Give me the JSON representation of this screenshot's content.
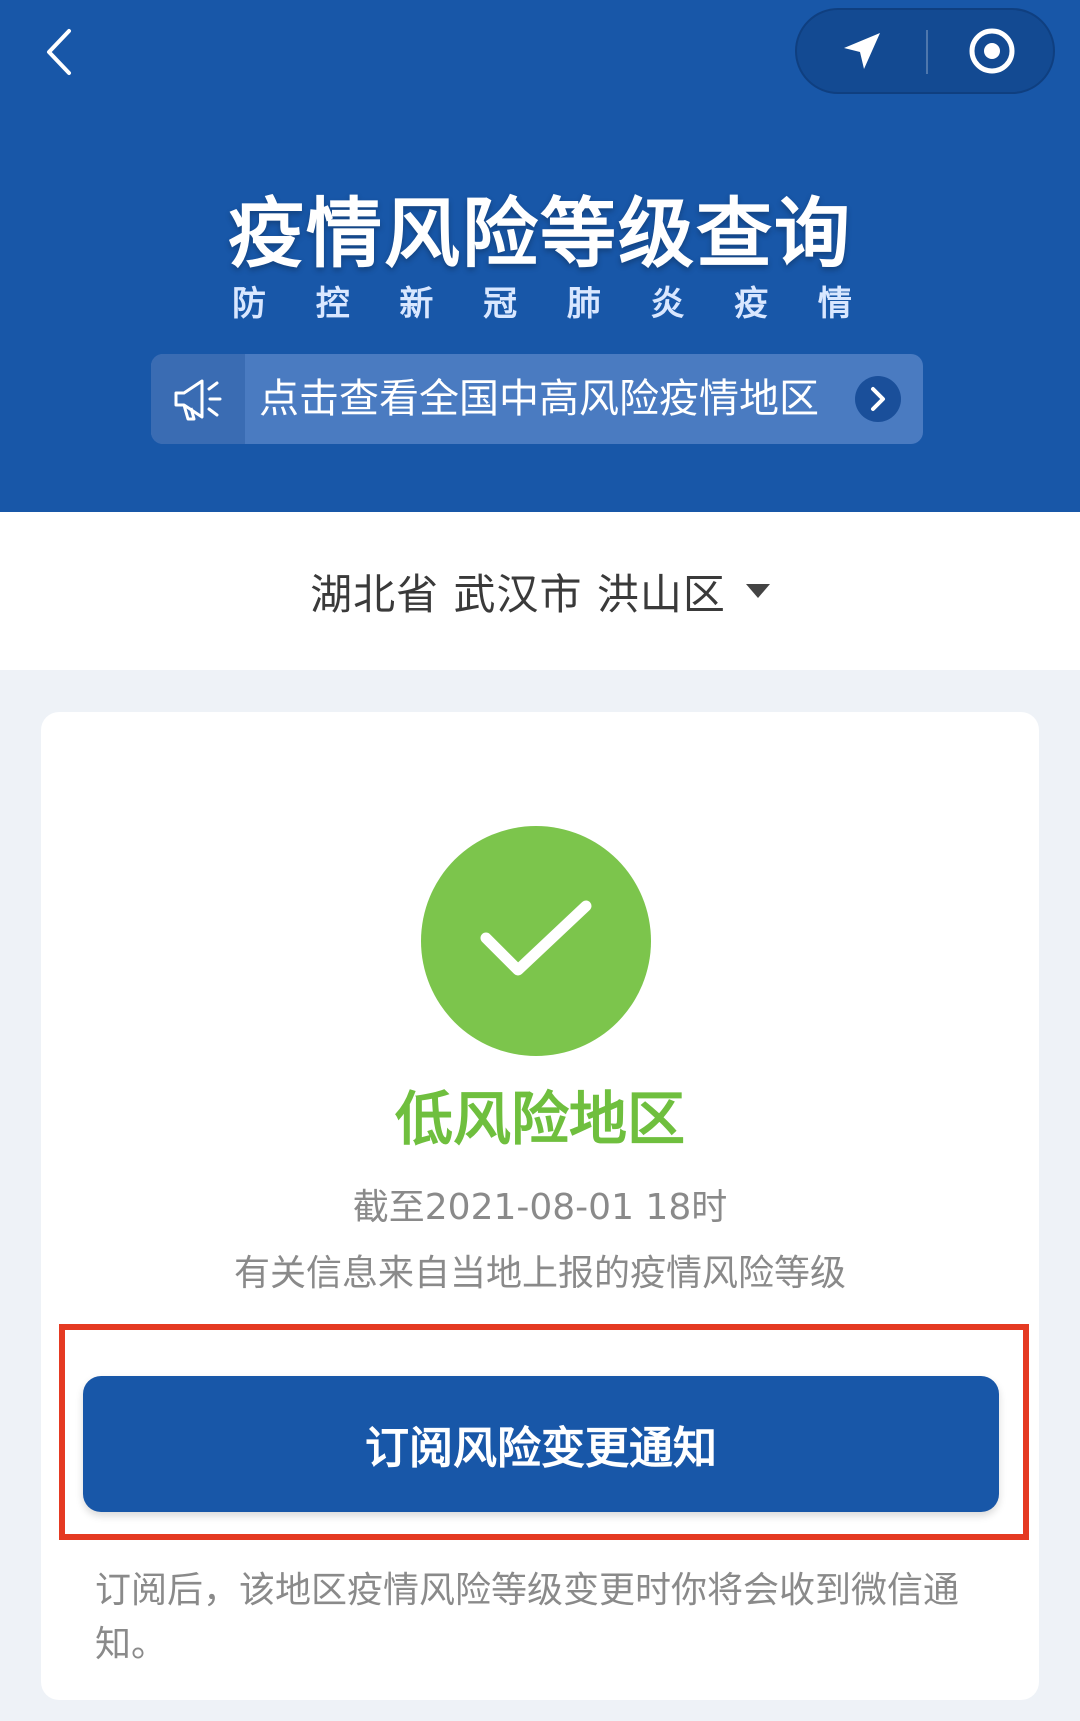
{
  "header": {
    "title": "疫情风险等级查询",
    "subtitle_chars": [
      "防",
      "控",
      "新",
      "冠",
      "肺",
      "炎",
      "疫",
      "情"
    ],
    "notice_text": "点击查看全国中高风险疫情地区",
    "icons": {
      "back": "chevron-left-icon",
      "location": "navigation-arrow-icon",
      "record": "target-circle-icon",
      "notice": "megaphone-icon",
      "notice_arrow": "chevron-right-icon"
    }
  },
  "location": {
    "text": "湖北省 武汉市 洪山区"
  },
  "status": {
    "label": "低风险地区",
    "time": "截至2021-08-01 18时",
    "source": "有关信息来自当地上报的疫情风险等级"
  },
  "subscribe": {
    "button_label": "订阅风险变更通知",
    "note": "订阅后，该地区疫情风险等级变更时你将会收到微信通知。"
  },
  "colors": {
    "brand_blue": "#1857a8",
    "low_risk_green": "#7cc54c",
    "highlight_red": "#e53a22"
  }
}
